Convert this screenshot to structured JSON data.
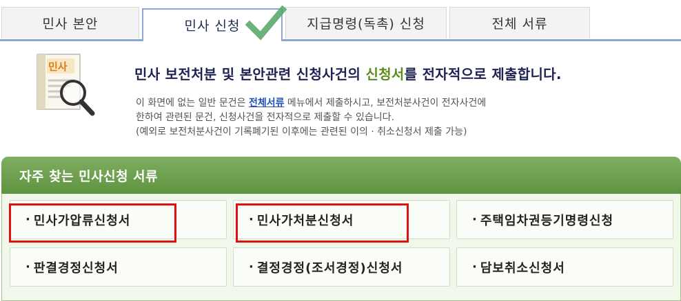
{
  "tabs": [
    {
      "label": "민사 본안"
    },
    {
      "label": "민사 신청"
    },
    {
      "label": "지급명령(독촉) 신청"
    },
    {
      "label": "전체 서류"
    }
  ],
  "active_tab": "민사 신청",
  "icon_label": "민사",
  "intro": {
    "headline_pre": "민사 보전처분 및 본안관련 신청사건의 ",
    "headline_highlight": "신청서",
    "headline_post": "를 전자적으로 제출합니다.",
    "line1_pre": "이 화면에 없는 일반 문건은 ",
    "line1_link": "전체서류",
    "line1_post": " 메뉴에서 제출하시고, 보전처분사건이 전자사건에",
    "line2": "한하여 관련된 문건, 신청사건을 전자적으로 제출할 수 있습니다.",
    "line3": "(예외로 보전처분사건이 기록폐기된 이후에는 관련된 이의 · 취소신청서 제출 가능)"
  },
  "panel": {
    "title": "자주 찾는 민사신청 서류",
    "items": [
      {
        "label": "민사가압류신청서"
      },
      {
        "label": "민사가처분신청서"
      },
      {
        "label": "주택임차권등기명령신청"
      },
      {
        "label": "판결경정신청서"
      },
      {
        "label": "결정경정(조서경정)신청서"
      },
      {
        "label": "담보취소신청서"
      }
    ],
    "bullet": "·"
  },
  "colors": {
    "tab_border": "#8aa5d6",
    "highlight_green": "#5b8c1a",
    "panel_green": "#6b9e4b",
    "check_green": "#5aa86b",
    "red_box": "#e01010"
  }
}
